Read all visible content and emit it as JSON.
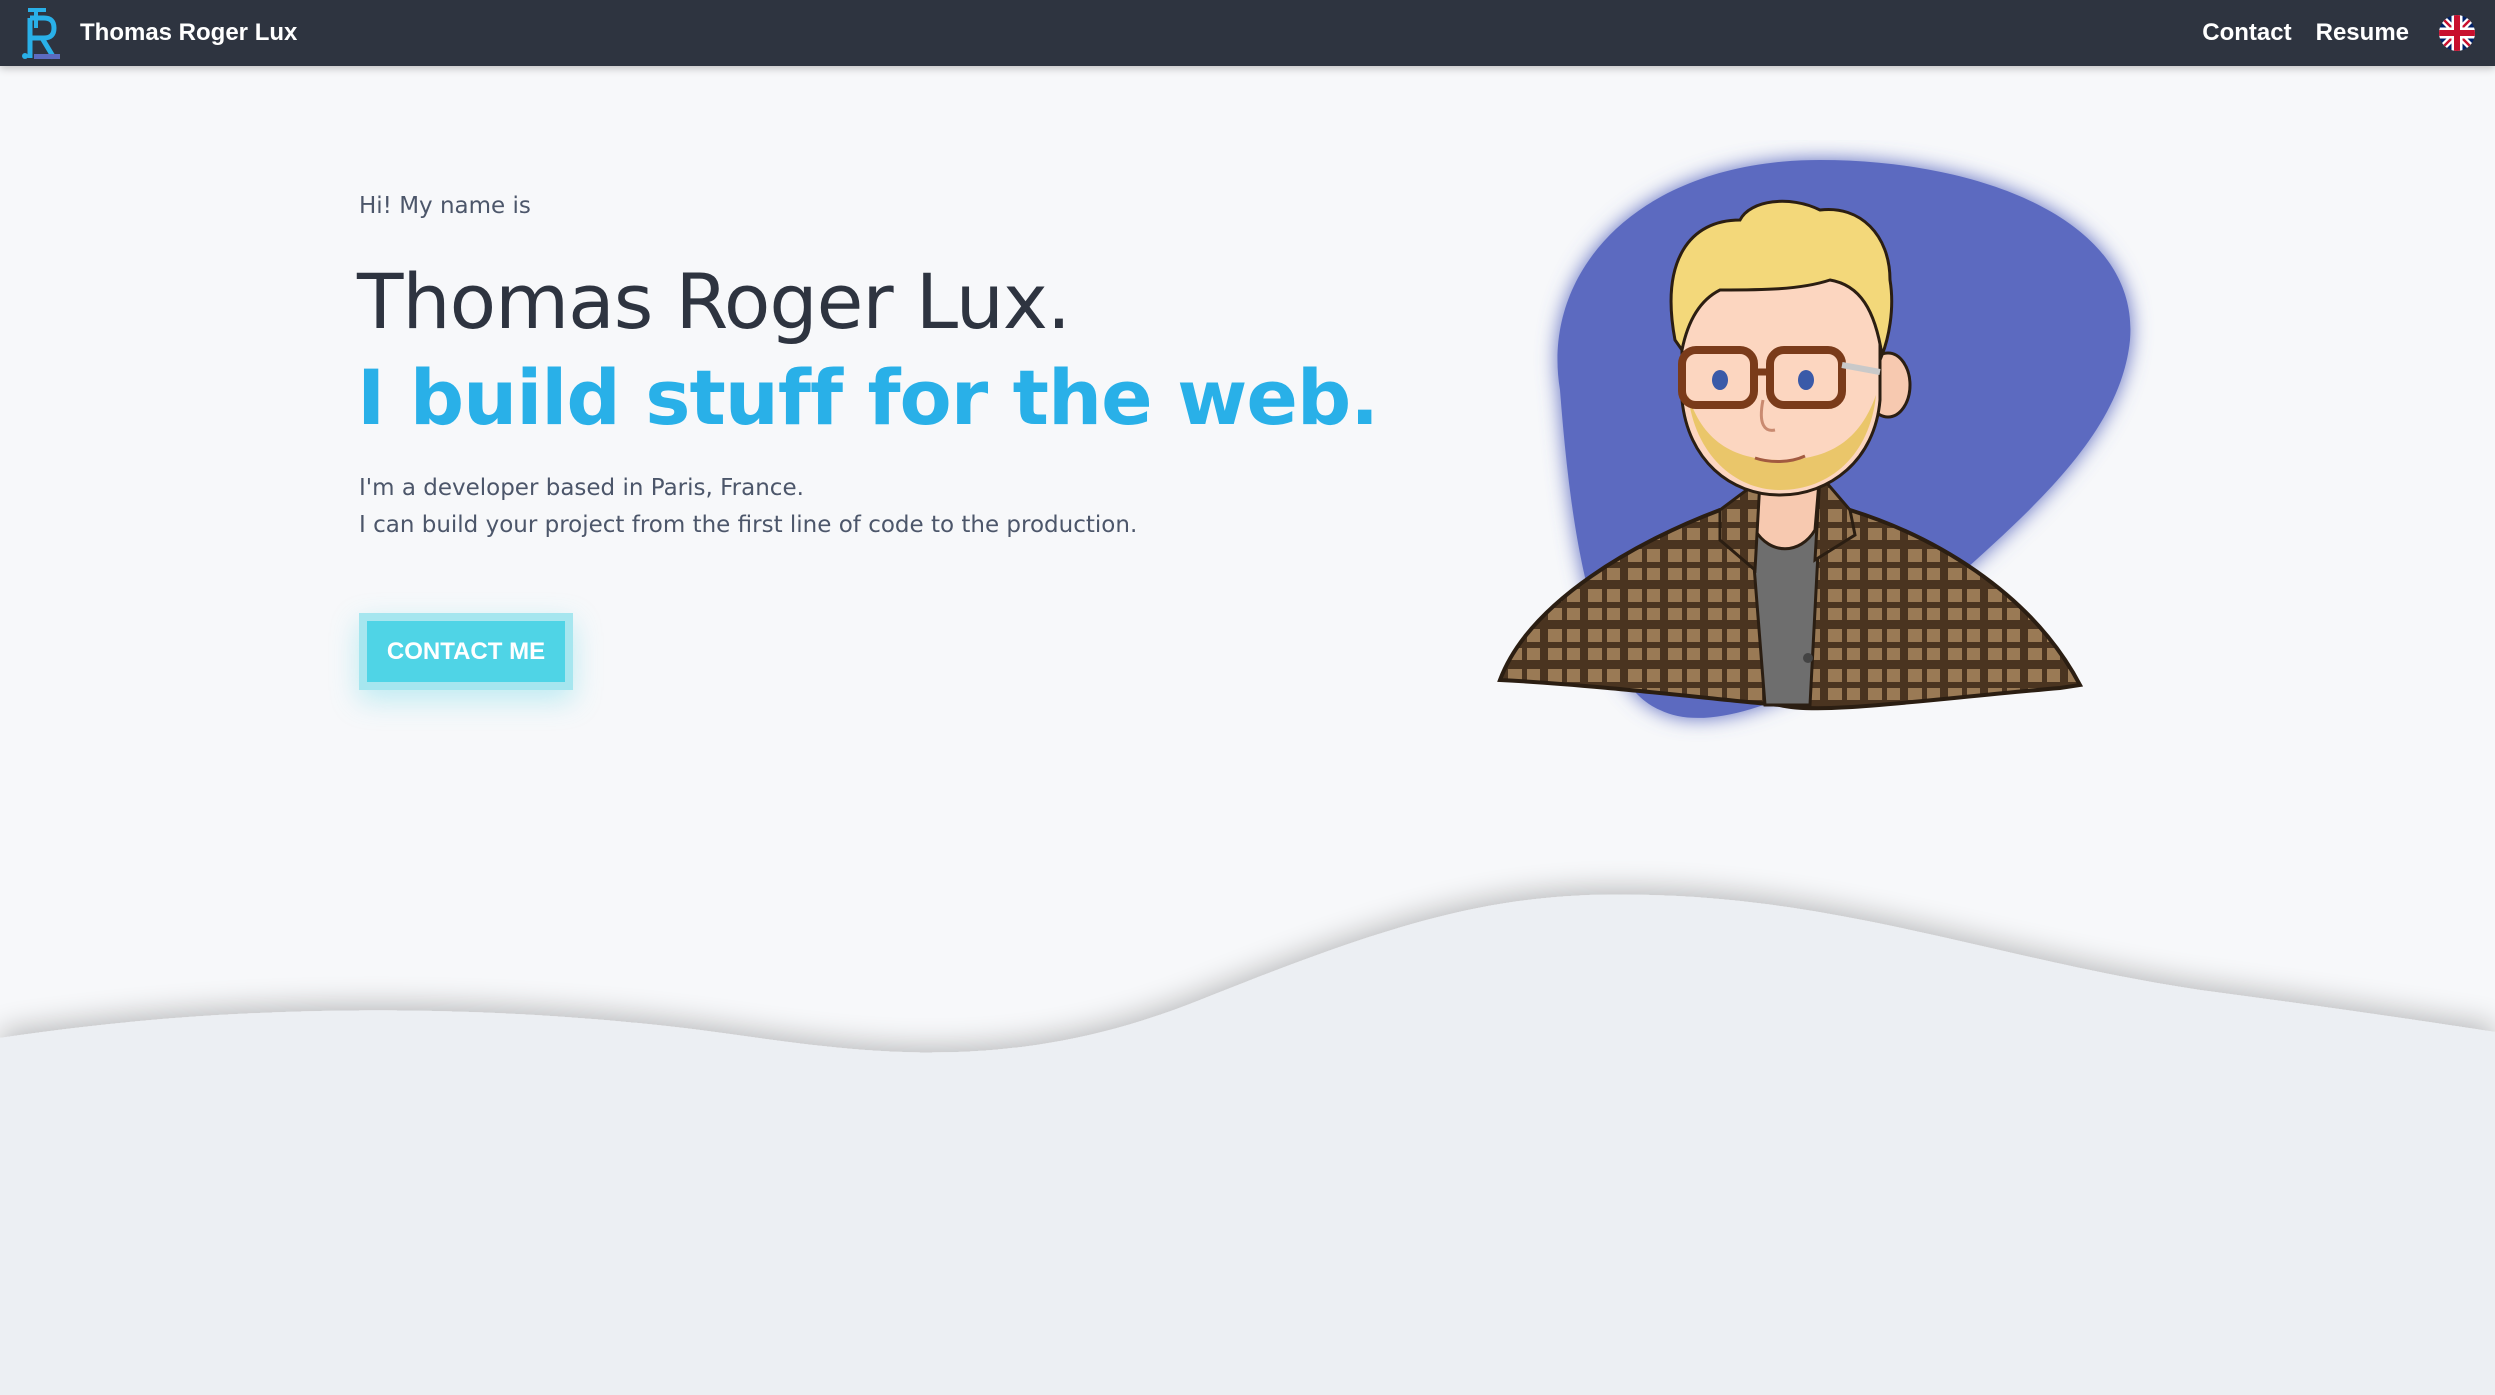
{
  "navbar": {
    "brand_name": "Thomas Roger Lux",
    "links": [
      "Contact",
      "Resume"
    ],
    "language_icon": "uk-flag-icon"
  },
  "hero": {
    "greeting": "Hi! My name is",
    "name": "Thomas Roger Lux.",
    "tagline": "I build stuff for the web.",
    "intro_lines": [
      "I'm a developer based in Paris, France.",
      "I can build your project from the first line of code to the production."
    ],
    "cta_label": "CONTACT ME",
    "avatar_icon": "cartoon-portrait-illustration"
  },
  "colors": {
    "nav_background": "#2e3440",
    "accent_blue": "#29b0e8",
    "button_cyan": "#4fd4e6",
    "avatar_blob": "#5c6bc0",
    "page_background": "#f7f8fa"
  }
}
